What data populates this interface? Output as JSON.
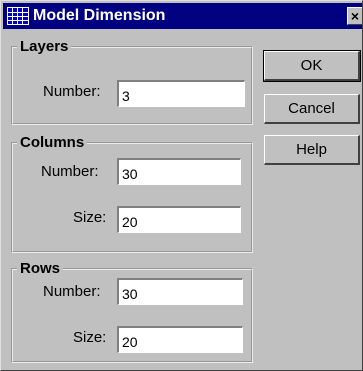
{
  "window": {
    "title": "Model Dimension",
    "close_glyph": "×",
    "icon": "grid-icon"
  },
  "layers": {
    "legend": "Layers",
    "number_label": "Number:",
    "number_value": "3"
  },
  "columns": {
    "legend": "Columns",
    "number_label": "Number:",
    "number_value": "30",
    "size_label": "Size:",
    "size_value": "20"
  },
  "rows": {
    "legend": "Rows",
    "number_label": "Number:",
    "number_value": "30",
    "size_label": "Size:",
    "size_value": "20"
  },
  "buttons": {
    "ok": "OK",
    "cancel": "Cancel",
    "help": "Help"
  }
}
